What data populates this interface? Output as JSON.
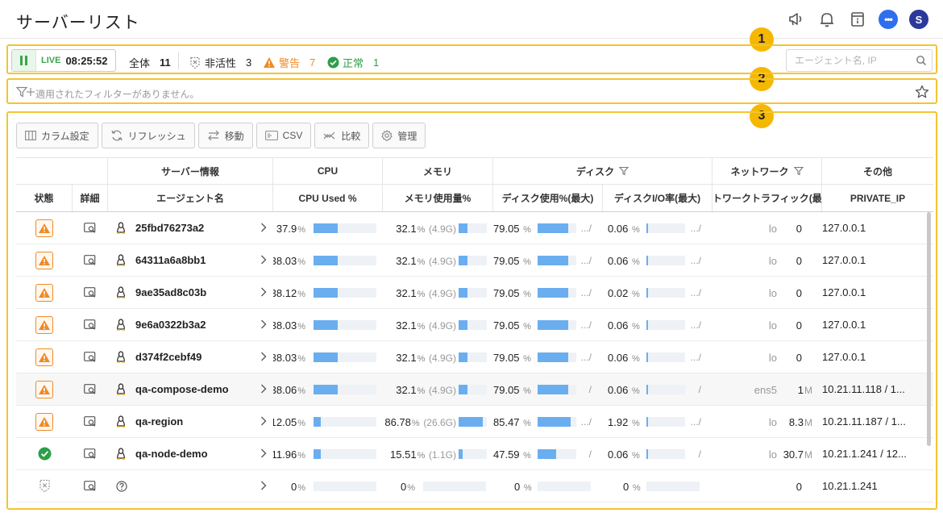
{
  "header": {
    "title": "サーバーリスト",
    "icons": [
      "megaphone-icon",
      "bell-icon",
      "info-icon",
      "chat-icon",
      "user-avatar"
    ],
    "avatar_letter": "S",
    "chat_label": "•••"
  },
  "markers": [
    "1",
    "2",
    "3"
  ],
  "status_bar": {
    "live_label": "LIVE",
    "live_time": "08:25:52",
    "total_label": "全体",
    "total_count": "11",
    "inactive_label": "非活性",
    "inactive_count": "3",
    "warning_label": "警告",
    "warning_count": "7",
    "normal_label": "正常",
    "normal_count": "1",
    "search_placeholder": "エージェント名, IP",
    "colors": {
      "live": "#3ba44a",
      "warning": "#f08a24",
      "normal": "#2e9e48"
    }
  },
  "filter_bar": {
    "text": "適用されたフィルターがありません。"
  },
  "toolbar": {
    "column_settings": "カラム設定",
    "refresh": "リフレッシュ",
    "move": "移動",
    "csv": "CSV",
    "compare": "比較",
    "manage": "管理"
  },
  "table": {
    "group_headers": {
      "server_info": "サーバー情報",
      "cpu": "CPU",
      "memory": "メモリ",
      "disk": "ディスク",
      "network": "ネットワーク",
      "other": "その他"
    },
    "column_headers": {
      "status": "状態",
      "detail": "詳細",
      "agent_name": "エージェント名",
      "cpu_used": "CPU Used %",
      "mem_used": "メモリ使用量%",
      "disk_used": "ディスク使用%(最大)",
      "disk_io": "ディスクI/O率(最大)",
      "net_traffic": "トワークトラフィック(最",
      "private_ip": "PRIVATE_IP"
    },
    "rows": [
      {
        "status": "warning",
        "agent_icon": "linux-icon",
        "name": "25fbd76273a2",
        "cpu": "37.9",
        "cpu_pct": 37.9,
        "mem": "32.1",
        "mem_size": "(4.9G)",
        "mem_pct": 32.1,
        "disk": "79.05",
        "disk_pct": 79.05,
        "disk_suffix": ".../",
        "io": "0.06",
        "io_pct": 0.06,
        "io_suffix": ".../",
        "if": "lo",
        "traffic": "0",
        "traffic_unit": "",
        "ip": "127.0.0.1"
      },
      {
        "status": "warning",
        "agent_icon": "linux-icon",
        "name": "64311a6a8bb1",
        "cpu": "38.03",
        "cpu_pct": 38.03,
        "mem": "32.1",
        "mem_size": "(4.9G)",
        "mem_pct": 32.1,
        "disk": "79.05",
        "disk_pct": 79.05,
        "disk_suffix": ".../",
        "io": "0.06",
        "io_pct": 0.06,
        "io_suffix": ".../",
        "if": "lo",
        "traffic": "0",
        "traffic_unit": "",
        "ip": "127.0.0.1"
      },
      {
        "status": "warning",
        "agent_icon": "linux-icon",
        "name": "9ae35ad8c03b",
        "cpu": "38.12",
        "cpu_pct": 38.12,
        "mem": "32.1",
        "mem_size": "(4.9G)",
        "mem_pct": 32.1,
        "disk": "79.05",
        "disk_pct": 79.05,
        "disk_suffix": ".../",
        "io": "0.02",
        "io_pct": 0.02,
        "io_suffix": ".../",
        "if": "lo",
        "traffic": "0",
        "traffic_unit": "",
        "ip": "127.0.0.1"
      },
      {
        "status": "warning",
        "agent_icon": "linux-icon",
        "name": "9e6a0322b3a2",
        "cpu": "38.03",
        "cpu_pct": 38.03,
        "mem": "32.1",
        "mem_size": "(4.9G)",
        "mem_pct": 32.1,
        "disk": "79.05",
        "disk_pct": 79.05,
        "disk_suffix": ".../",
        "io": "0.06",
        "io_pct": 0.06,
        "io_suffix": ".../",
        "if": "lo",
        "traffic": "0",
        "traffic_unit": "",
        "ip": "127.0.0.1"
      },
      {
        "status": "warning",
        "agent_icon": "linux-icon",
        "name": "d374f2cebf49",
        "cpu": "38.03",
        "cpu_pct": 38.03,
        "mem": "32.1",
        "mem_size": "(4.9G)",
        "mem_pct": 32.1,
        "disk": "79.05",
        "disk_pct": 79.05,
        "disk_suffix": ".../",
        "io": "0.06",
        "io_pct": 0.06,
        "io_suffix": ".../",
        "if": "lo",
        "traffic": "0",
        "traffic_unit": "",
        "ip": "127.0.0.1"
      },
      {
        "status": "warning",
        "agent_icon": "linux-icon",
        "name": "qa-compose-demo",
        "cpu": "38.06",
        "cpu_pct": 38.06,
        "mem": "32.1",
        "mem_size": "(4.9G)",
        "mem_pct": 32.1,
        "disk": "79.05",
        "disk_pct": 79.05,
        "disk_suffix": "/",
        "io": "0.06",
        "io_pct": 0.06,
        "io_suffix": "/",
        "if": "ens5",
        "traffic": "1",
        "traffic_unit": "M",
        "ip": "10.21.11.118 / 1..."
      },
      {
        "status": "warning",
        "agent_icon": "linux-icon",
        "name": "qa-region",
        "cpu": "12.05",
        "cpu_pct": 12.05,
        "mem": "86.78",
        "mem_size": "(26.6G)",
        "mem_pct": 86.78,
        "disk": "85.47",
        "disk_pct": 85.47,
        "disk_suffix": ".../",
        "io": "1.92",
        "io_pct": 1.92,
        "io_suffix": ".../",
        "if": "lo",
        "traffic": "8.3",
        "traffic_unit": "M",
        "ip": "10.21.11.187 / 1..."
      },
      {
        "status": "normal",
        "agent_icon": "linux-icon",
        "name": "qa-node-demo",
        "cpu": "11.96",
        "cpu_pct": 11.96,
        "mem": "15.51",
        "mem_size": "(1.1G)",
        "mem_pct": 15.51,
        "disk": "47.59",
        "disk_pct": 47.59,
        "disk_suffix": "/",
        "io": "0.06",
        "io_pct": 0.06,
        "io_suffix": "/",
        "if": "lo",
        "traffic": "30.7",
        "traffic_unit": "M",
        "ip": "10.21.1.241 / 12..."
      },
      {
        "status": "inactive",
        "agent_icon": "question-icon",
        "name": "",
        "cpu": "0",
        "cpu_pct": 0,
        "mem": "0",
        "mem_size": "",
        "mem_pct": 0,
        "disk": "0",
        "disk_pct": 0,
        "disk_suffix": "",
        "io": "0",
        "io_pct": 0,
        "io_suffix": "",
        "if": "",
        "traffic": "0",
        "traffic_unit": "",
        "ip": "10.21.1.241"
      }
    ]
  }
}
